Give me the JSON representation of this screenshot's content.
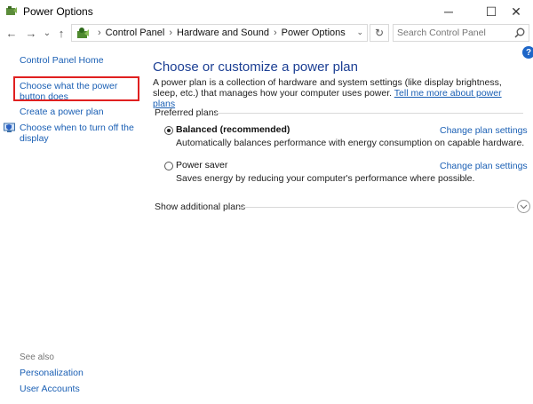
{
  "window": {
    "title": "Power Options",
    "minimize_glyph": "─",
    "maximize_glyph": "☐",
    "close_glyph": "✕"
  },
  "nav": {
    "back_glyph": "←",
    "forward_glyph": "→",
    "recent_glyph": "⌄",
    "up_glyph": "↑",
    "breadcrumbs": [
      "Control Panel",
      "Hardware and Sound",
      "Power Options"
    ],
    "separator": "›",
    "dropdown_glyph": "⌄",
    "refresh_glyph": "↻",
    "search_placeholder": "Search Control Panel"
  },
  "sidebar": {
    "home": "Control Panel Home",
    "items": [
      "Choose what the power button does",
      "Create a power plan",
      "Choose when to turn off the display"
    ],
    "see_also_label": "See also",
    "see_also": [
      "Personalization",
      "User Accounts"
    ]
  },
  "main": {
    "heading": "Choose or customize a power plan",
    "description": "A power plan is a collection of hardware and system settings (like display brightness, sleep, etc.) that manages how your computer uses power.",
    "learn_more": "Tell me more about power plans",
    "preferred_label": "Preferred plans",
    "plans": [
      {
        "name": "Balanced (recommended)",
        "selected": true,
        "description": "Automatically balances performance with energy consumption on capable hardware.",
        "change_link": "Change plan settings"
      },
      {
        "name": "Power saver",
        "selected": false,
        "description": "Saves energy by reducing your computer's performance where possible.",
        "change_link": "Change plan settings"
      }
    ],
    "show_additional": "Show additional plans",
    "help_glyph": "?"
  },
  "colors": {
    "link": "#1a5fb4",
    "heading": "#1c3f94",
    "highlight_box": "#e02020"
  },
  "icons": {
    "app": "power-options-icon",
    "location": "control-panel-icon",
    "search": "search-icon",
    "display_shield": "shield-icon",
    "expand": "chevron-down-icon"
  }
}
